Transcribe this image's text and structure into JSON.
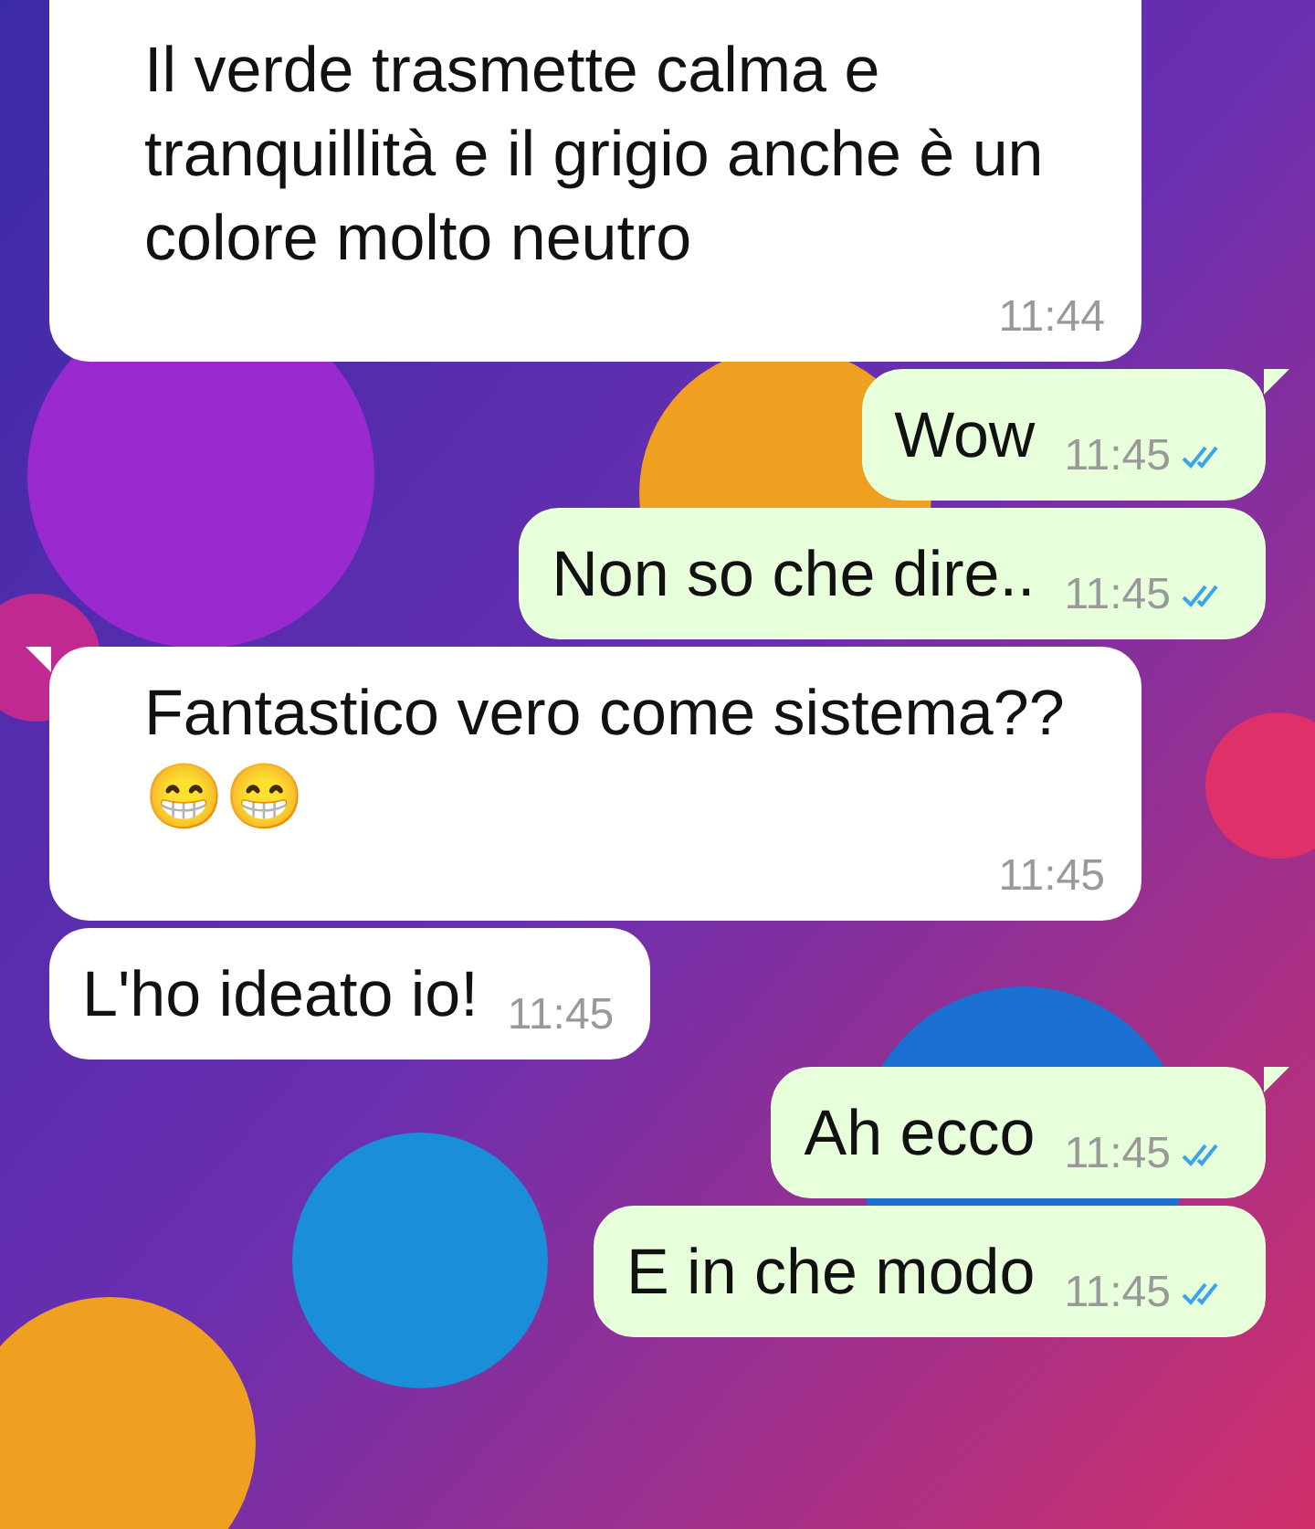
{
  "messages": [
    {
      "kind": "incoming",
      "text": "Il verde trasmette calma e tranquillità e il grigio anche è un colore molto neutro",
      "time": "11:44",
      "tail": false
    },
    {
      "kind": "outgoing",
      "text": "Wow",
      "time": "11:45",
      "read": true,
      "tail": true
    },
    {
      "kind": "outgoing",
      "text": "Non so che dire..",
      "time": "11:45",
      "read": true,
      "tail": false
    },
    {
      "kind": "incoming",
      "text": "Fantastico vero come sistema??😁😁",
      "time": "11:45",
      "tail": true
    },
    {
      "kind": "incoming",
      "text": "L'ho ideato io!",
      "time": "11:45",
      "tail": false
    },
    {
      "kind": "outgoing",
      "text": "Ah ecco",
      "time": "11:45",
      "read": true,
      "tail": true
    },
    {
      "kind": "outgoing",
      "text": "E in che modo",
      "time": "11:45",
      "read": true,
      "tail": false
    }
  ]
}
